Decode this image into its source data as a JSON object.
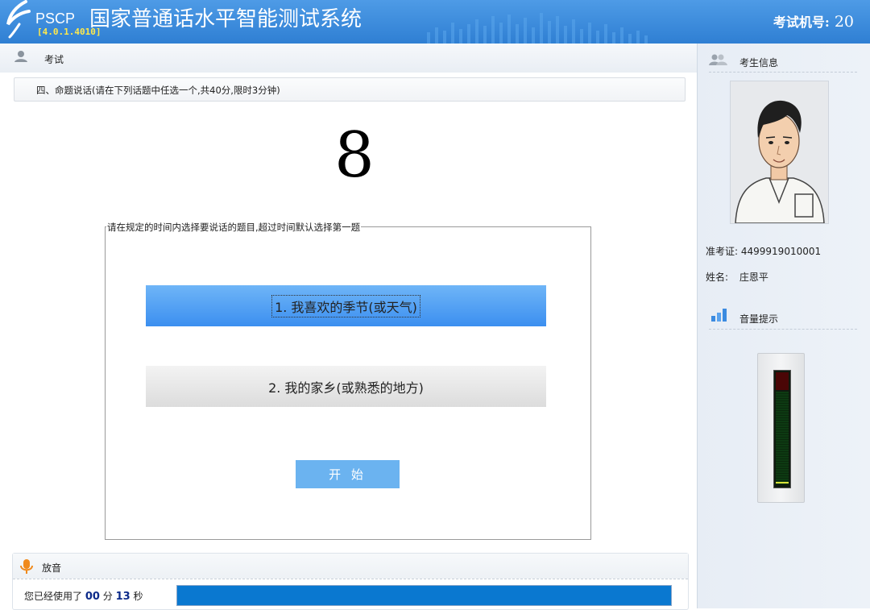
{
  "header": {
    "logo_text": "PSCP",
    "title": "国家普通话水平智能测试系统",
    "version": "[4.0.1.4010]",
    "machine_label": "考试机号:",
    "machine_number": "20"
  },
  "main": {
    "section_title": "考试",
    "question_title": "四、命题说话(请在下列话题中任选一个,共40分,限时3分钟)",
    "countdown": "8",
    "instruction": "请在规定的时间内选择要说话的题目,超过时间默认选择第一题",
    "topics": [
      {
        "label": "1. 我喜欢的季节(或天气)",
        "selected": true
      },
      {
        "label": "2. 我的家乡(或熟悉的地方)",
        "selected": false
      }
    ],
    "start_label": "开 始"
  },
  "playback": {
    "title": "放音",
    "used_prefix": "您已经使用了",
    "minutes": "00",
    "minutes_unit": "分",
    "seconds": "13",
    "seconds_unit": "秒",
    "progress_fraction": 1.0
  },
  "sidebar": {
    "candidate_title": "考生信息",
    "ticket_label": "准考证:",
    "ticket_number": "4499919010001",
    "name_label": "姓名:",
    "name_value": "庄恩平",
    "volume_title": "音量提示",
    "volume_level": 0.02
  },
  "colors": {
    "header": "#3a8ddd",
    "selected_topic": "#4a9cf3",
    "start_button": "#6bb3f0",
    "progress": "#0a78d0"
  }
}
